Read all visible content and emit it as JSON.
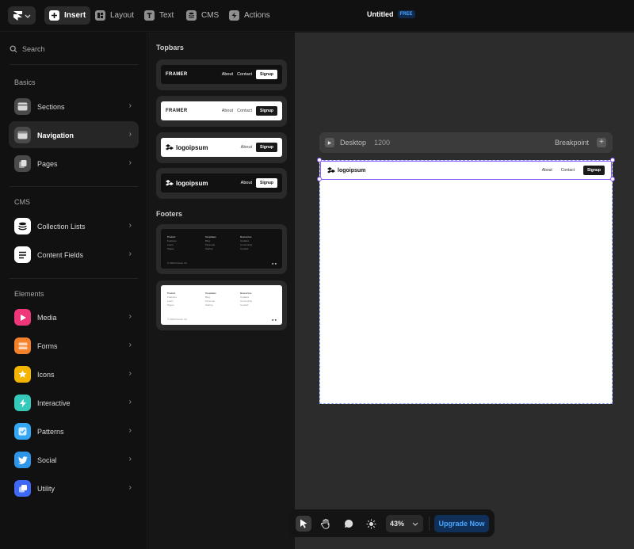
{
  "toolbar": {
    "items": [
      {
        "label": "Insert",
        "icon": "plus-icon",
        "active": true
      },
      {
        "label": "Layout",
        "icon": "layout-icon",
        "active": false
      },
      {
        "label": "Text",
        "icon": "text-icon",
        "active": false
      },
      {
        "label": "CMS",
        "icon": "database-icon",
        "active": false
      },
      {
        "label": "Actions",
        "icon": "lightning-icon",
        "active": false
      }
    ],
    "doc_title": "Untitled",
    "plan_badge": "FREE"
  },
  "sidebar": {
    "search_label": "Search",
    "sections": [
      {
        "label": "Basics",
        "items": [
          {
            "label": "Sections",
            "icon": "sections-icon",
            "color": "#5a5a5a"
          },
          {
            "label": "Navigation",
            "icon": "navigation-icon",
            "color": "#5a5a5a",
            "active": true
          },
          {
            "label": "Pages",
            "icon": "pages-icon",
            "color": "#5a5a5a"
          }
        ]
      },
      {
        "label": "CMS",
        "items": [
          {
            "label": "Collection Lists",
            "icon": "database-icon",
            "color": "#ffffff"
          },
          {
            "label": "Content Fields",
            "icon": "lines-icon",
            "color": "#ffffff"
          }
        ]
      },
      {
        "label": "Elements",
        "items": [
          {
            "label": "Media",
            "icon": "play-icon",
            "color": "#f0367a"
          },
          {
            "label": "Forms",
            "icon": "form-icon",
            "color": "#f5822b"
          },
          {
            "label": "Icons",
            "icon": "star-icon",
            "color": "#f5b400"
          },
          {
            "label": "Interactive",
            "icon": "bolt-icon",
            "color": "#35c9b9"
          },
          {
            "label": "Patterns",
            "icon": "check-icon",
            "color": "#33a6f5"
          },
          {
            "label": "Social",
            "icon": "twitter-icon",
            "color": "#2f95e9"
          },
          {
            "label": "Utility",
            "icon": "stack-icon",
            "color": "#3f68f5"
          }
        ]
      }
    ]
  },
  "insert_panel": {
    "topbars_label": "Topbars",
    "footers_label": "Footers",
    "topbars": [
      {
        "theme": "dark",
        "brand": "FRAMER",
        "links": [
          "About",
          "Contact"
        ],
        "button": "Signup"
      },
      {
        "theme": "light",
        "brand": "FRAMER",
        "links": [
          "About",
          "Contact"
        ],
        "button": "Signup"
      },
      {
        "theme": "light",
        "brand": "logoipsum",
        "links": [
          "About"
        ],
        "button": "Signup"
      },
      {
        "theme": "dark",
        "brand": "logoipsum",
        "links": [
          "About"
        ],
        "button": "Signup"
      }
    ],
    "footers": [
      {
        "theme": "dark",
        "columns": [
          {
            "head": "Product",
            "lines": [
              "Features",
              "Learn",
              "Pages"
            ]
          },
          {
            "head": "Templates",
            "lines": [
              "Blog",
              "Personal",
              "Startup"
            ]
          },
          {
            "head": "Resources",
            "lines": [
              "Updates",
              "Community",
              "Contact"
            ]
          }
        ],
        "copyright": "© 2024 Framer Inc"
      },
      {
        "theme": "light",
        "columns": [
          {
            "head": "Product",
            "lines": [
              "Features",
              "Learn",
              "Pages"
            ]
          },
          {
            "head": "Templates",
            "lines": [
              "Blog",
              "Personal",
              "Startup"
            ]
          },
          {
            "head": "Resources",
            "lines": [
              "Updates",
              "Community",
              "Contact"
            ]
          }
        ],
        "copyright": "© 2024 Framer Inc"
      }
    ]
  },
  "canvas": {
    "breakpoint_name": "Desktop",
    "breakpoint_width": "1200",
    "breakpoint_label": "Breakpoint",
    "frame_nav": {
      "brand": "logoipsum",
      "links": [
        "About",
        "Contact"
      ],
      "button": "Signup"
    }
  },
  "bottom_toolbar": {
    "zoom": "43%",
    "upgrade_label": "Upgrade Now"
  }
}
